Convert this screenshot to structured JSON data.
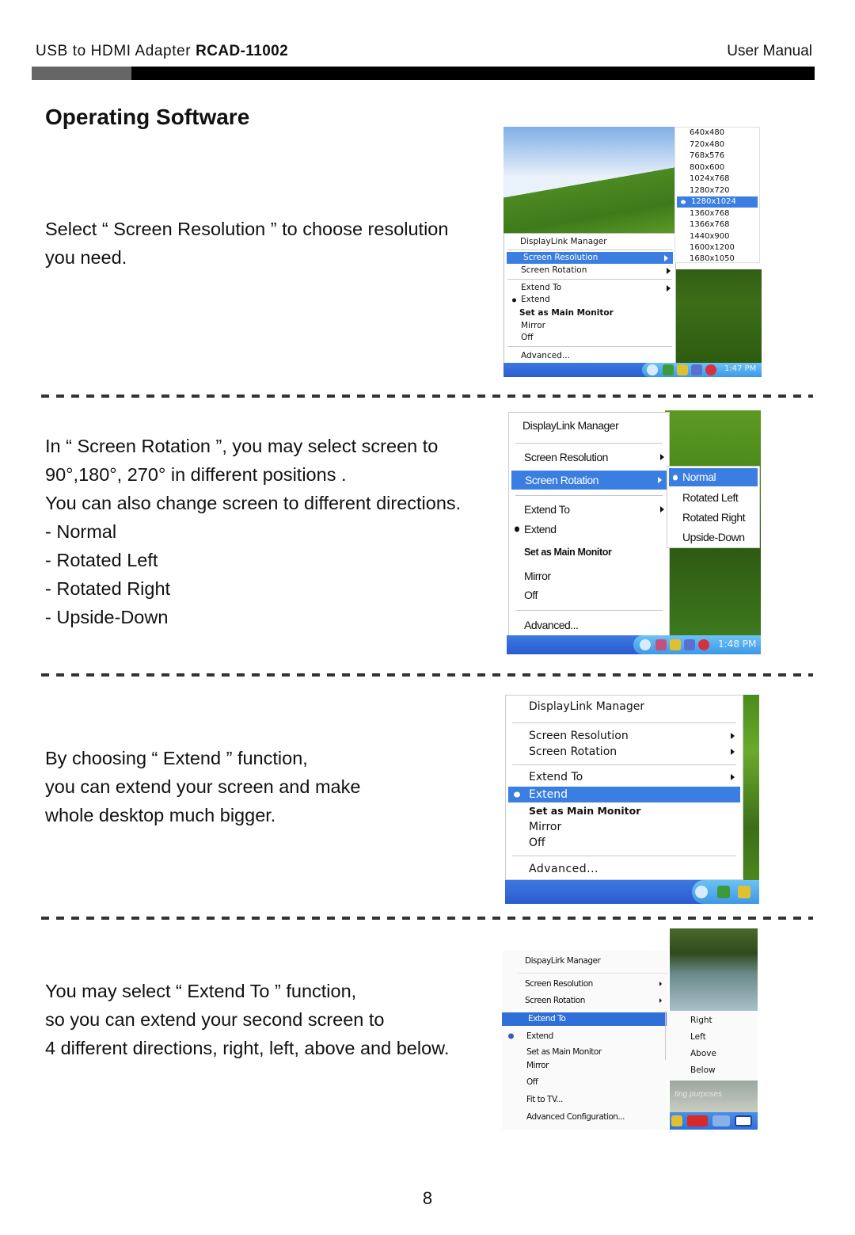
{
  "header": {
    "product": "USB to HDMI Adapter",
    "model": "RCAD-11002",
    "doc_type": "User Manual"
  },
  "page_title": "Operating Software",
  "sections": [
    {
      "text_lines": [
        "Select “ Screen Resolution ” to choose resolution",
        "you need."
      ],
      "screenshot": {
        "menu_title": "DisplayLink Manager",
        "menu_items": [
          {
            "label": "Screen Resolution",
            "submenu": true,
            "selected": true
          },
          {
            "label": "Screen Rotation",
            "submenu": true
          },
          {
            "label": "Extend To",
            "submenu": true
          },
          {
            "label": "Extend",
            "checked": true
          },
          {
            "label": "Set as Main Monitor",
            "bold": true
          },
          {
            "label": "Mirror"
          },
          {
            "label": "Off"
          },
          {
            "label": "Advanced..."
          }
        ],
        "submenu_items": [
          "640x480",
          "720x480",
          "768x576",
          "800x600",
          "1024x768",
          "1280x720",
          "1280x1024",
          "1360x768",
          "1366x768",
          "1440x900",
          "1600x1200",
          "1680x1050"
        ],
        "submenu_selected": "1280x1024",
        "clock": "1:47 PM"
      }
    },
    {
      "text_lines": [
        "In “ Screen Rotation ”, you may select screen to",
        "90°,180°, 270° in different positions .",
        "You can also change screen to different directions.",
        "- Normal",
        "- Rotated Left",
        "- Rotated Right",
        "- Upside-Down"
      ],
      "screenshot": {
        "menu_title": "DisplayLink Manager",
        "menu_items": [
          {
            "label": "Screen Resolution",
            "submenu": true
          },
          {
            "label": "Screen Rotation",
            "submenu": true,
            "selected": true
          },
          {
            "label": "Extend To",
            "submenu": true
          },
          {
            "label": "Extend",
            "checked": true
          },
          {
            "label": "Set as Main Monitor",
            "bold": true
          },
          {
            "label": "Mirror"
          },
          {
            "label": "Off"
          },
          {
            "label": "Advanced..."
          }
        ],
        "submenu_items": [
          "Normal",
          "Rotated Left",
          "Rotated Right",
          "Upside-Down"
        ],
        "submenu_selected": "Normal",
        "clock": "1:48 PM"
      }
    },
    {
      "text_lines": [
        "By choosing “ Extend ” function,",
        "you can extend your screen and make",
        "whole desktop much bigger."
      ],
      "screenshot": {
        "menu_title": "DisplayLink Manager",
        "menu_items": [
          {
            "label": "Screen Resolution",
            "submenu": true
          },
          {
            "label": "Screen Rotation",
            "submenu": true
          },
          {
            "label": "Extend To",
            "submenu": true
          },
          {
            "label": "Extend",
            "checked": true,
            "selected": true
          },
          {
            "label": "Set as Main Monitor",
            "bold": true
          },
          {
            "label": "Mirror"
          },
          {
            "label": "Off"
          },
          {
            "label": "Advanced..."
          }
        ]
      }
    },
    {
      "text_lines": [
        "You may select “ Extend To ” function,",
        "so you can extend your second screen to",
        "4 different directions, right, left, above and below."
      ],
      "screenshot": {
        "menu_title": "DispayLirk Manager",
        "menu_items": [
          {
            "label": "Screen Resolution",
            "submenu": true
          },
          {
            "label": "Screen Rotation",
            "submenu": true
          },
          {
            "label": "Extend To",
            "selected": true
          },
          {
            "label": "Extend",
            "checked": true
          },
          {
            "label": "Set as Main Monitor"
          },
          {
            "label": "Mirror"
          },
          {
            "label": "Off"
          },
          {
            "label": "Fit to TV..."
          },
          {
            "label": "Advanced Configuration..."
          }
        ],
        "submenu_items": [
          "Right",
          "Left",
          "Above",
          "Below"
        ],
        "background_caption": "ting purposes"
      }
    }
  ],
  "page_number": "8",
  "colors": {
    "menu_highlight": "#3a7ee2",
    "header_bar": "#000000",
    "header_bar_accent": "#666666",
    "taskbar": "#2a5dd0"
  }
}
